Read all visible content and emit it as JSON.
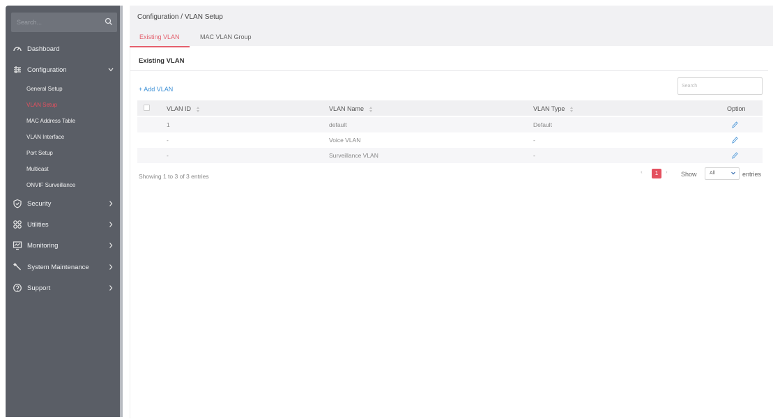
{
  "sidebar": {
    "search_placeholder": "Search...",
    "items": [
      {
        "label": "Dashboard",
        "icon": "dashboard-icon"
      },
      {
        "label": "Configuration",
        "icon": "sliders-icon"
      },
      {
        "label": "Security",
        "icon": "shield-icon"
      },
      {
        "label": "Utilities",
        "icon": "grid-icon"
      },
      {
        "label": "Monitoring",
        "icon": "monitor-icon"
      },
      {
        "label": "System Maintenance",
        "icon": "wrench-icon"
      },
      {
        "label": "Support",
        "icon": "help-icon"
      }
    ],
    "config_subitems": [
      "General Setup",
      "VLAN Setup",
      "MAC Address Table",
      "VLAN Interface",
      "Port Setup",
      "Multicast",
      "ONVIF Surveillance"
    ],
    "active_subitem": "VLAN Setup"
  },
  "header": {
    "breadcrumb": "Configuration / VLAN Setup",
    "tabs": [
      {
        "label": "Existing VLAN",
        "active": true
      },
      {
        "label": "MAC VLAN Group",
        "active": false
      }
    ]
  },
  "card": {
    "title": "Existing VLAN",
    "add_label": "+ Add VLAN",
    "search_placeholder": "Search"
  },
  "table": {
    "columns": [
      "VLAN ID",
      "VLAN Name",
      "VLAN Type",
      "Option"
    ],
    "rows": [
      {
        "id": "1",
        "name": "default",
        "type": "Default"
      },
      {
        "id": "-",
        "name": "Voice VLAN",
        "type": "-"
      },
      {
        "id": "-",
        "name": "Surveillance VLAN",
        "type": "-"
      }
    ]
  },
  "footer": {
    "showing": "Showing 1 to 3 of 3 entries",
    "prev": "‹",
    "page": "1",
    "next": "›",
    "show_label": "Show",
    "page_size": "All",
    "entries_label": "entries"
  },
  "colors": {
    "sidebar_bg": "#5a5e66",
    "accent": "#e4606d",
    "link": "#3a8fd6",
    "header_bg": "#f1f1f3"
  }
}
